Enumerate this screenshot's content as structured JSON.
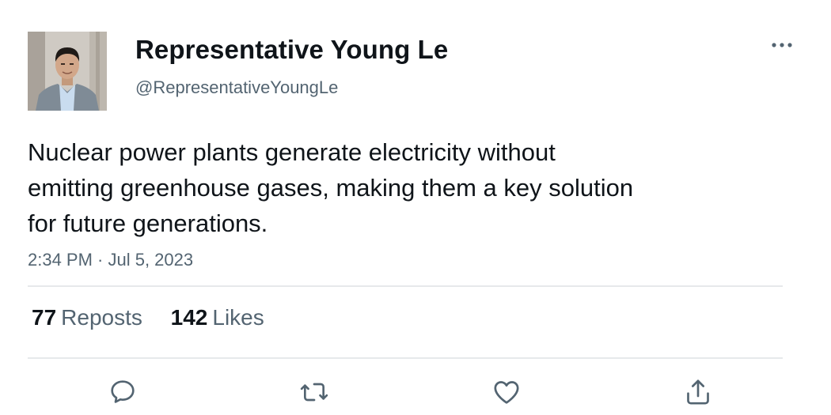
{
  "tweet": {
    "author": {
      "display_name": "Representative Young Le",
      "handle": "@RepresentativeYoungLe"
    },
    "text": "Nuclear power plants generate electricity without\nemitting greenhouse gases, making them a key solution\nfor future generations.",
    "timestamp": "2:34 PM · Jul 5, 2023",
    "stats": {
      "reposts_count": "77",
      "reposts_label": "Reposts",
      "likes_count": "142",
      "likes_label": "Likes"
    },
    "actions": [
      "reply-icon",
      "repost-icon",
      "like-icon",
      "share-icon"
    ],
    "menu_icon": "more-options-icon"
  },
  "colors": {
    "text_primary": "#0f1419",
    "text_secondary": "#536471",
    "divider": "#e6e9eb",
    "icon": "#536471"
  }
}
